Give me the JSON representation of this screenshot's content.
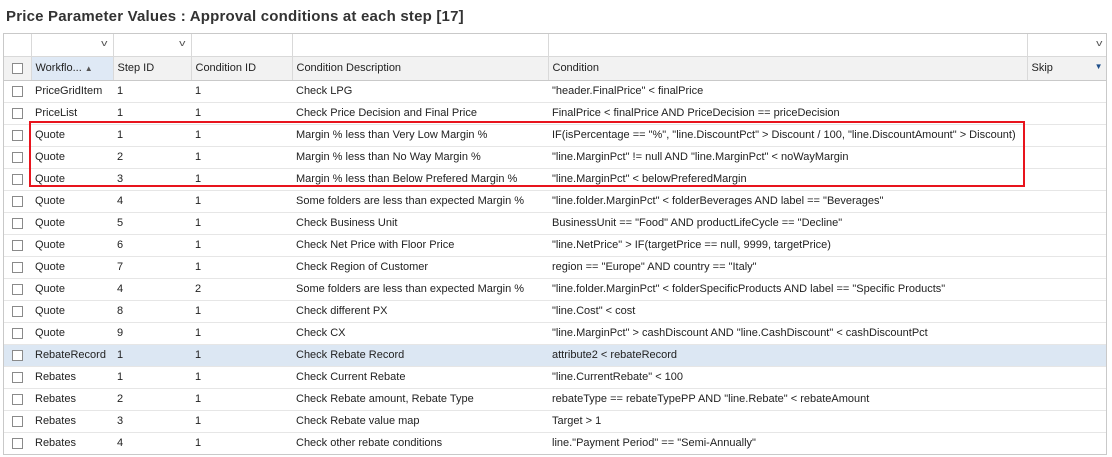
{
  "page_title": "Price Parameter Values : Approval conditions at each step [17]",
  "columns": [
    {
      "label": "Workflo...",
      "sort": "▲",
      "sorted": true,
      "filter": true
    },
    {
      "label": "Step ID",
      "filter": true
    },
    {
      "label": "Condition ID",
      "filter": false
    },
    {
      "label": "Condition Description",
      "filter": false
    },
    {
      "label": "Condition",
      "filter": false
    },
    {
      "label": "Skip",
      "filter": true,
      "menu": "▼"
    }
  ],
  "filter_icon": "chevron-down-icon",
  "highlight_color": "#e8141d",
  "selected_row_color": "#dce7f3",
  "rows": [
    {
      "workflow": "PriceGridItem",
      "step": "1",
      "cond_id": "1",
      "desc": "Check LPG",
      "cond": "\"header.FinalPrice\" < finalPrice",
      "skip": ""
    },
    {
      "workflow": "PriceList",
      "step": "1",
      "cond_id": "1",
      "desc": "Check Price Decision and Final Price",
      "cond": "FinalPrice < finalPrice AND PriceDecision == priceDecision",
      "skip": ""
    },
    {
      "workflow": "Quote",
      "step": "1",
      "cond_id": "1",
      "desc": "Margin % less than Very Low Margin %",
      "cond": "IF(isPercentage == \"%\", \"line.DiscountPct\" > Discount / 100, \"line.DiscountAmount\" > Discount)",
      "skip": ""
    },
    {
      "workflow": "Quote",
      "step": "2",
      "cond_id": "1",
      "desc": "Margin % less than No Way Margin %",
      "cond": "\"line.MarginPct\" != null AND \"line.MarginPct\" < noWayMargin",
      "skip": ""
    },
    {
      "workflow": "Quote",
      "step": "3",
      "cond_id": "1",
      "desc": "Margin % less than Below Prefered Margin %",
      "cond": "\"line.MarginPct\" < belowPreferedMargin",
      "skip": ""
    },
    {
      "workflow": "Quote",
      "step": "4",
      "cond_id": "1",
      "desc": "Some folders are less than expected Margin %",
      "cond": "\"line.folder.MarginPct\" < folderBeverages AND label == \"Beverages\"",
      "skip": ""
    },
    {
      "workflow": "Quote",
      "step": "5",
      "cond_id": "1",
      "desc": "Check Business Unit",
      "cond": "BusinessUnit == \"Food\" AND productLifeCycle == \"Decline\"",
      "skip": ""
    },
    {
      "workflow": "Quote",
      "step": "6",
      "cond_id": "1",
      "desc": "Check Net Price with Floor Price",
      "cond": "\"line.NetPrice\" > IF(targetPrice == null, 9999, targetPrice)",
      "skip": ""
    },
    {
      "workflow": "Quote",
      "step": "7",
      "cond_id": "1",
      "desc": "Check Region of Customer",
      "cond": "region == \"Europe\" AND country == \"Italy\"",
      "skip": ""
    },
    {
      "workflow": "Quote",
      "step": "4",
      "cond_id": "2",
      "desc": "Some folders are less than expected Margin %",
      "cond": "\"line.folder.MarginPct\" < folderSpecificProducts AND label == \"Specific Products\"",
      "skip": ""
    },
    {
      "workflow": "Quote",
      "step": "8",
      "cond_id": "1",
      "desc": "Check different PX",
      "cond": "\"line.Cost\" < cost",
      "skip": ""
    },
    {
      "workflow": "Quote",
      "step": "9",
      "cond_id": "1",
      "desc": "Check CX",
      "cond": "\"line.MarginPct\" > cashDiscount AND \"line.CashDiscount\" < cashDiscountPct",
      "skip": ""
    },
    {
      "workflow": "RebateRecord",
      "step": "1",
      "cond_id": "1",
      "desc": "Check Rebate Record",
      "cond": "attribute2 < rebateRecord",
      "skip": "",
      "selected": true
    },
    {
      "workflow": "Rebates",
      "step": "1",
      "cond_id": "1",
      "desc": "Check Current Rebate",
      "cond": "\"line.CurrentRebate\" < 100",
      "skip": ""
    },
    {
      "workflow": "Rebates",
      "step": "2",
      "cond_id": "1",
      "desc": "Check Rebate amount, Rebate Type",
      "cond": "rebateType == rebateTypePP AND \"line.Rebate\" < rebateAmount",
      "skip": ""
    },
    {
      "workflow": "Rebates",
      "step": "3",
      "cond_id": "1",
      "desc": "Check Rebate value map",
      "cond": "Target > 1",
      "skip": ""
    },
    {
      "workflow": "Rebates",
      "step": "4",
      "cond_id": "1",
      "desc": "Check other rebate conditions",
      "cond": "line.\"Payment Period\" == \"Semi-Annually\"",
      "skip": ""
    }
  ]
}
